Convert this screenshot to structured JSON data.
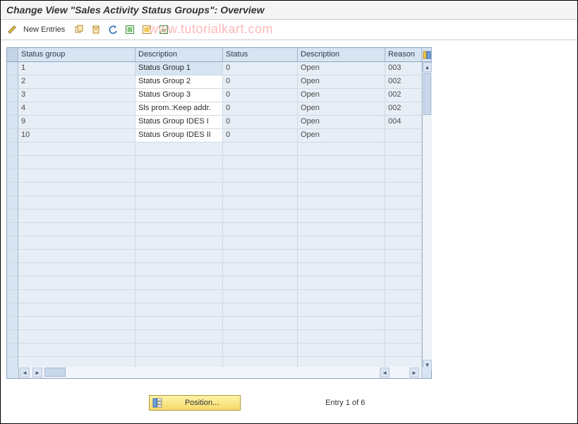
{
  "title": "Change View \"Sales Activity Status Groups\": Overview",
  "toolbar": {
    "new_entries_label": "New Entries"
  },
  "watermark": "www.tutorialkart.com",
  "table": {
    "headers": {
      "status_group": "Status group",
      "description1": "Description",
      "status": "Status",
      "description2": "Description",
      "reason": "Reason"
    },
    "rows": [
      {
        "group": "1",
        "desc1": "Status Group 1",
        "status": "0",
        "desc2": "Open",
        "reason": "003"
      },
      {
        "group": "2",
        "desc1": "Status Group 2",
        "status": "0",
        "desc2": "Open",
        "reason": "002"
      },
      {
        "group": "3",
        "desc1": "Status Group 3",
        "status": "0",
        "desc2": "Open",
        "reason": "002"
      },
      {
        "group": "4",
        "desc1": "Sls prom.:Keep addr.",
        "status": "0",
        "desc2": "Open",
        "reason": "002"
      },
      {
        "group": "9",
        "desc1": "Status Group IDES I",
        "status": "0",
        "desc2": "Open",
        "reason": "004"
      },
      {
        "group": "10",
        "desc1": "Status Group IDES II",
        "status": "0",
        "desc2": "Open",
        "reason": ""
      }
    ],
    "empty_rows": 17
  },
  "footer": {
    "position_label": "Position...",
    "entry_text": "Entry 1 of 6"
  }
}
